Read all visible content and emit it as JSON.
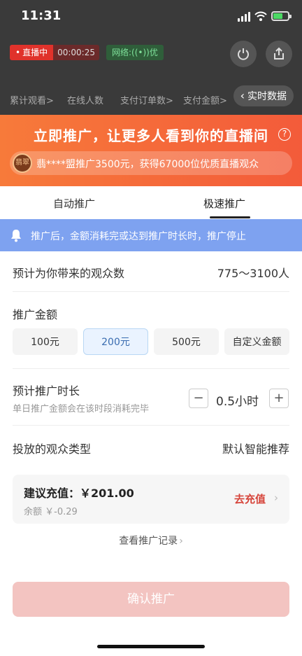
{
  "status_bar": {
    "time": "11:31"
  },
  "live_header": {
    "live_label": "直播中",
    "timer": "00:00:25",
    "network_label": "网络:((•))优",
    "stats": [
      {
        "label": "累计观看",
        "arrow": ">"
      },
      {
        "label": "在线人数",
        "arrow": ""
      },
      {
        "label": "支付订单数",
        "arrow": ">"
      },
      {
        "label": "支付金额",
        "arrow": ">"
      }
    ],
    "realtime_label": "实时数据"
  },
  "banner": {
    "title": "立即推广，让更多人看到你的直播间",
    "help_glyph": "?",
    "avatar_text": "翡翠",
    "notice": "翡****盟推广3500元，获得67000位优质直播观众"
  },
  "tabs": [
    {
      "label": "自动推广",
      "active": false
    },
    {
      "label": "极速推广",
      "active": true
    }
  ],
  "info_bar": {
    "text": "推广后，金额消耗完或达到推广时长时，推广停止"
  },
  "audience_estimate": {
    "label": "预计为你带来的观众数",
    "value": "775～3100人"
  },
  "amount": {
    "label": "推广金额",
    "options": [
      "100元",
      "200元",
      "500元",
      "自定义金额"
    ],
    "selected_index": 1
  },
  "duration": {
    "label": "预计推广时长",
    "hint": "单日推广金额会在该时段消耗完毕",
    "value": "0.5小时",
    "minus": "−",
    "plus": "+"
  },
  "audience_type": {
    "label": "投放的观众类型",
    "value": "默认智能推荐"
  },
  "recharge": {
    "title": "建议充值：￥201.00",
    "balance": "余额 ￥-0.29",
    "action": "去充值",
    "chevron": "›"
  },
  "record_link": {
    "label": "查看推广记录",
    "chevron": "›"
  },
  "confirm_button": {
    "label": "确认推广"
  },
  "colors": {
    "accent_orange": "#f35b3a",
    "info_blue": "#7ea2f0",
    "confirm_disabled": "#f3c4c1",
    "link_red": "#d6443a"
  }
}
